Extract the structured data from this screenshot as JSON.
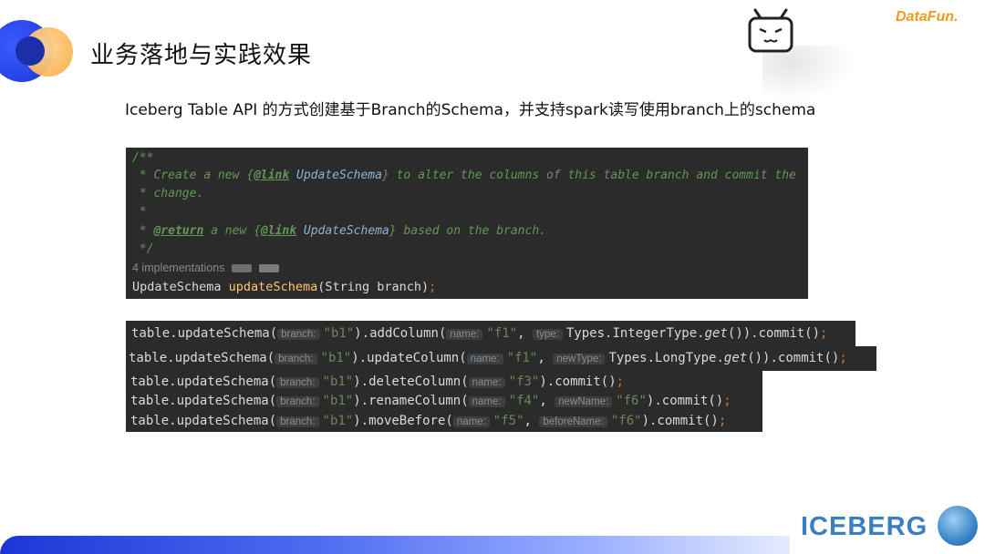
{
  "slide": {
    "title": "业务落地与实践效果",
    "subtitle": "Iceberg Table API 的方式创建基于Branch的Schema，并支持spark读写使用branch上的schema",
    "brand": "DataFun.",
    "footer_logo": "ICEBERG"
  },
  "javadoc": {
    "line1": "/**",
    "line2_pre": " * Create a new {",
    "line2_tag": "@link",
    "line2_ref": " UpdateSchema",
    "line2_post": "} to alter the columns of this table branch and commit the",
    "line3": " * change.",
    "line4": " *",
    "line5_pre": " * ",
    "line5_tag": "@return",
    "line5_mid": " a new {",
    "line5_tag2": "@link",
    "line5_ref": " UpdateSchema",
    "line5_post": "} based on the branch.",
    "line6": " */",
    "implementations": "4 implementations",
    "sig_type": "UpdateSchema ",
    "sig_method": "updateSchema",
    "sig_params": "(String branch)",
    "sig_semi": ";"
  },
  "calls": [
    {
      "pre": "table.updateSchema(",
      "h1": "branch:",
      "a1": "\"b1\"",
      "m": ").addColumn(",
      "h2": "name:",
      "a2": "\"f1\"",
      "sep": ", ",
      "h3": "type:",
      "a3": "Types.IntegerType.",
      "a3i": "get",
      "post": "()).commit()",
      "semi": ";"
    },
    {
      "pre": "table.updateSchema(",
      "h1": "branch:",
      "a1": "\"b1\"",
      "m": ").updateColumn(",
      "h2": "name:",
      "a2": "\"f1\"",
      "sep": ", ",
      "h3": "newType:",
      "a3": "Types.LongType.",
      "a3i": "get",
      "post": "()).commit()",
      "semi": ";"
    },
    {
      "pre": "table.updateSchema(",
      "h1": "branch:",
      "a1": "\"b1\"",
      "m": ").deleteColumn(",
      "h2": "name:",
      "a2": "\"f3\"",
      "post": ").commit()",
      "semi": ";"
    },
    {
      "pre": "table.updateSchema(",
      "h1": "branch:",
      "a1": "\"b1\"",
      "m": ").renameColumn(",
      "h2": "name:",
      "a2": "\"f4\"",
      "sep": ", ",
      "h3": "newName:",
      "a3": "\"f6\"",
      "post": ").commit()",
      "semi": ";"
    },
    {
      "pre": "table.updateSchema(",
      "h1": "branch:",
      "a1": "\"b1\"",
      "m": ").moveBefore(",
      "h2": "name:",
      "a2": "\"f5\"",
      "sep": ", ",
      "h3": "beforeName:",
      "a3": "\"f6\"",
      "post": ").commit()",
      "semi": ";"
    }
  ]
}
